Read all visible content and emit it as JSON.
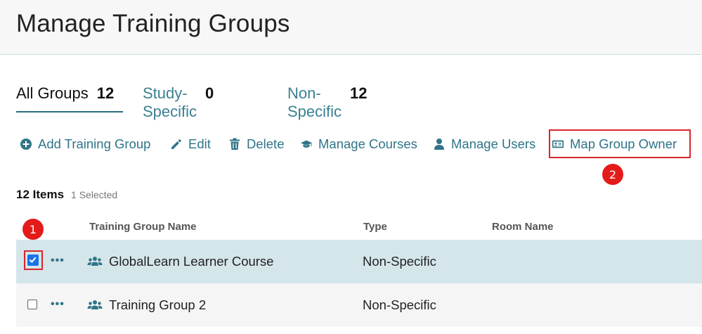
{
  "page": {
    "title": "Manage Training Groups"
  },
  "tabs": [
    {
      "label": "All Groups",
      "count": "12"
    },
    {
      "label": "Study-Specific",
      "count": "0"
    },
    {
      "label": "Non-Specific",
      "count": "12"
    }
  ],
  "toolbar": {
    "add": "Add Training Group",
    "edit": "Edit",
    "delete": "Delete",
    "manage_courses": "Manage Courses",
    "manage_users": "Manage Users",
    "map_group_owner": "Map Group Owner"
  },
  "summary": {
    "items": "12 Items",
    "selected": "1 Selected"
  },
  "columns": {
    "name": "Training Group Name",
    "type": "Type",
    "room": "Room Name"
  },
  "rows": [
    {
      "name": "GlobalLearn Learner Course",
      "type": "Non-Specific",
      "room": "",
      "checked": true
    },
    {
      "name": "Training Group 2",
      "type": "Non-Specific",
      "room": "",
      "checked": false
    }
  ],
  "callouts": {
    "one": "1",
    "two": "2"
  },
  "row_actions": {
    "more": "•••"
  },
  "colors": {
    "accent": "#2f7488",
    "selected_row": "#d5e6eb",
    "annotation": "#d9252b"
  },
  "icons": [
    "plus-circle-icon",
    "pencil-icon",
    "trash-icon",
    "graduation-cap-icon",
    "user-icon",
    "id-card-icon",
    "users-group-icon"
  ]
}
